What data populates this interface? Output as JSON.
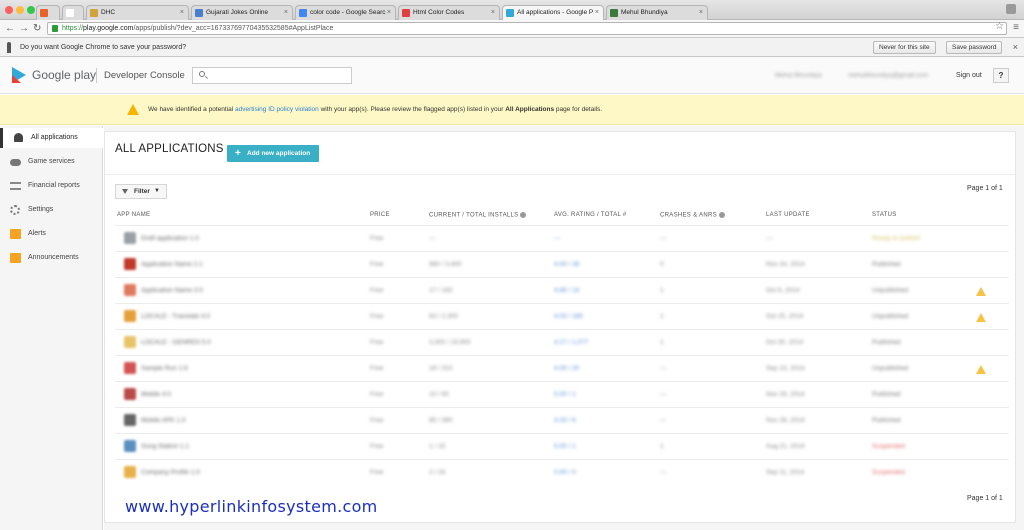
{
  "browser": {
    "tabs": [
      {
        "label": "",
        "color": "#e8622c"
      },
      {
        "label": "",
        "color": "#ffffff"
      },
      {
        "label": "DHC",
        "color": "#d4a23a"
      },
      {
        "label": "Gujarati Jokes Online",
        "color": "#4a7fd0"
      },
      {
        "label": "color code - Google Searc",
        "color": "#4285f4"
      },
      {
        "label": "Html Color Codes",
        "color": "#e04040"
      },
      {
        "label": "All applications - Google P",
        "color": "#33a9d9"
      },
      {
        "label": "Mehul Bhundiya",
        "color": "#3b7a3b"
      }
    ],
    "url_scheme": "https://",
    "url_host": "play.google.com",
    "url_path": "/apps/publish/?dev_acc=16733769770435532585#AppListPlace",
    "infobar_message": "Do you want Google Chrome to save your password?",
    "never_label": "Never for this site",
    "save_label": "Save password"
  },
  "header": {
    "brand": "Google play",
    "console": "Developer Console",
    "search_placeholder": "",
    "account_name": "Mehul Bhundiya",
    "account_email": "mehulbhundiya@gmail.com",
    "signout": "Sign out",
    "help": "?"
  },
  "warning": {
    "prefix": "We have identified a potential ",
    "link": "advertising ID policy violation",
    "middle": " with your app(s). Please review the flagged app(s) listed in your ",
    "bold": "All Applications",
    "suffix": " page for details."
  },
  "sidebar": {
    "items": [
      {
        "label": "All applications",
        "icon": "android-icon"
      },
      {
        "label": "Game services",
        "icon": "gamepad-icon"
      },
      {
        "label": "Financial reports",
        "icon": "financial-icon"
      },
      {
        "label": "Settings",
        "icon": "gear-icon"
      },
      {
        "label": "Alerts",
        "icon": "alert-icon"
      },
      {
        "label": "Announcements",
        "icon": "announcement-icon"
      }
    ]
  },
  "main": {
    "title": "ALL APPLICATIONS",
    "add_button": "Add new application",
    "filter": "Filter",
    "pager_top": "Page 1 of 1",
    "pager_bottom": "Page 1 of 1",
    "columns": [
      "APP NAME",
      "PRICE",
      "CURRENT / TOTAL INSTALLS",
      "AVG. RATING / TOTAL #",
      "CRASHES & ANRS",
      "LAST UPDATE",
      "STATUS"
    ],
    "rows": [
      {
        "name": "Draft application 1.0",
        "price": "Free",
        "installs": "—",
        "rating": "—",
        "crashes": "—",
        "updated": "—",
        "status": "Ready to publish",
        "icon": "#9aa0a6",
        "status_color": "#d9c46a",
        "warn": false
      },
      {
        "name": "Application Name 2.1",
        "price": "Free",
        "installs": "980 / 3,400",
        "rating": "4.00 / 28",
        "crashes": "0",
        "updated": "Nov 24, 2014",
        "status": "Published",
        "icon": "#c0392b",
        "status_color": "#777777",
        "warn": false
      },
      {
        "name": "Application Name 3.0",
        "price": "Free",
        "installs": "17 / 183",
        "rating": "4.86 / 14",
        "crashes": "1",
        "updated": "Oct 6, 2014",
        "status": "Unpublished",
        "icon": "#e07a5f",
        "status_color": "#777777",
        "warn": true
      },
      {
        "name": "LOCALE - Translate 4.0",
        "price": "Free",
        "installs": "63 / 2,300",
        "rating": "4.03 / 185",
        "crashes": "1",
        "updated": "Oct 25, 2014",
        "status": "Unpublished",
        "icon": "#e5a03b",
        "status_color": "#777777",
        "warn": true
      },
      {
        "name": "LOCALE - GENRES 5.0",
        "price": "Free",
        "installs": "3,300 / 19,900",
        "rating": "4.27 / 1,077",
        "crashes": "1",
        "updated": "Oct 30, 2014",
        "status": "Published",
        "icon": "#e8c36a",
        "status_color": "#777777",
        "warn": false
      },
      {
        "name": "Sample Run 1.6",
        "price": "Free",
        "installs": "18 / 310",
        "rating": "4.05 / 20",
        "crashes": "—",
        "updated": "Sep 15, 2014",
        "status": "Unpublished",
        "icon": "#d35454",
        "status_color": "#777777",
        "warn": true
      },
      {
        "name": "Mobile 4.0",
        "price": "Free",
        "installs": "10 / 60",
        "rating": "5.00 / 1",
        "crashes": "—",
        "updated": "Nov 28, 2014",
        "status": "Published",
        "icon": "#b94a48",
        "status_color": "#777777",
        "warn": false
      },
      {
        "name": "Mobile APK 1.0",
        "price": "Free",
        "installs": "85 / 390",
        "rating": "4.33 / 6",
        "crashes": "—",
        "updated": "Nov 28, 2014",
        "status": "Published",
        "icon": "#666666",
        "status_color": "#777777",
        "warn": false
      },
      {
        "name": "Song Station 1.1",
        "price": "Free",
        "installs": "1 / 15",
        "rating": "5.00 / 1",
        "crashes": "1",
        "updated": "Aug 21, 2014",
        "status": "Suspended",
        "icon": "#5a8fc0",
        "status_color": "#e06666",
        "warn": false
      },
      {
        "name": "Company Profile 1.0",
        "price": "Free",
        "installs": "2 / 16",
        "rating": "0.00 / 0",
        "crashes": "—",
        "updated": "Sep 11, 2014",
        "status": "Suspended",
        "icon": "#e8b04a",
        "status_color": "#e06666",
        "warn": false
      }
    ]
  },
  "watermark": "www.hyperlinkinfosystem.com"
}
